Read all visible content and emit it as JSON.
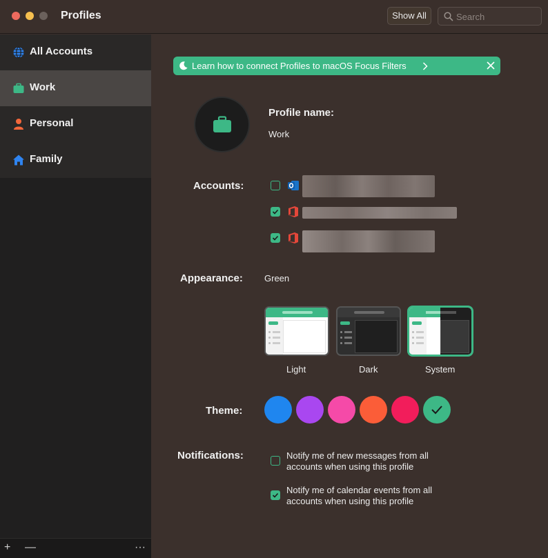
{
  "window": {
    "title": "Profiles"
  },
  "toolbar": {
    "show_all": "Show All",
    "search_placeholder": "Search"
  },
  "sidebar": {
    "items": [
      {
        "label": "All Accounts",
        "icon": "globe-icon",
        "color": "#2f84f0"
      },
      {
        "label": "Work",
        "icon": "briefcase-icon",
        "color": "#3db886",
        "active": true
      },
      {
        "label": "Personal",
        "icon": "person-icon",
        "color": "#f4673b"
      },
      {
        "label": "Family",
        "icon": "house-icon",
        "color": "#2f84f0"
      }
    ],
    "footer": {
      "add": "+",
      "remove": "—",
      "more": "···"
    }
  },
  "banner": {
    "text": "Learn how to connect Profiles to macOS Focus Filters"
  },
  "profile": {
    "name_label": "Profile name:",
    "name_value": "Work"
  },
  "accounts": {
    "label": "Accounts:",
    "items": [
      {
        "app": "outlook-icon",
        "checked": false
      },
      {
        "app": "office-icon",
        "checked": true
      },
      {
        "app": "office-icon",
        "checked": true
      }
    ]
  },
  "appearance": {
    "label": "Appearance:",
    "value": "Green",
    "options": [
      {
        "label": "Light"
      },
      {
        "label": "Dark"
      },
      {
        "label": "System",
        "selected": true
      }
    ]
  },
  "theme": {
    "label": "Theme:",
    "colors": [
      "#1f86ef",
      "#a947f0",
      "#f54aa8",
      "#fb5d38",
      "#f21d5b",
      "#3db886"
    ],
    "selected_index": 5
  },
  "notifications": {
    "label": "Notifications:",
    "items": [
      {
        "text": "Notify me of new messages from all accounts when using this profile",
        "checked": false
      },
      {
        "text": "Notify me of calendar events from all accounts when using this profile",
        "checked": true
      }
    ]
  },
  "colors": {
    "accent": "#3db886",
    "background": "#3b302c",
    "sidebar": "#201f1f"
  }
}
